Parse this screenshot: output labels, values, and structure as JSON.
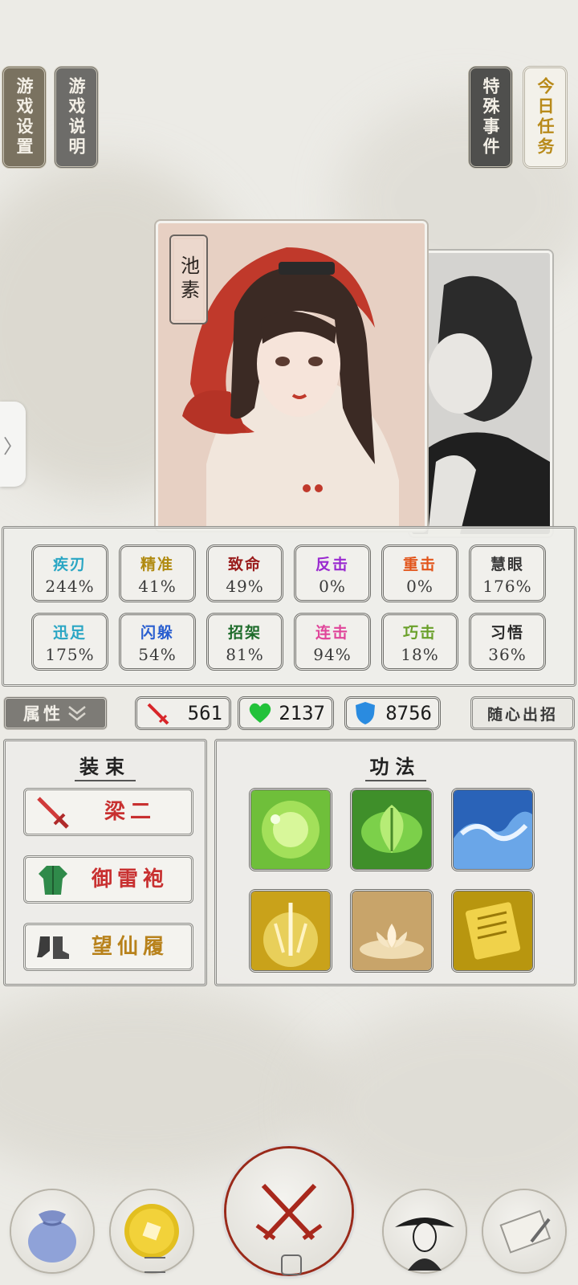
{
  "top_tags": {
    "game_settings": "游戏设置",
    "game_guide": "游戏说明",
    "special_events": "特殊事件",
    "daily_tasks": "今日任务"
  },
  "character": {
    "name": "池素"
  },
  "side_handle": {
    "glyph": "〉"
  },
  "stats": [
    {
      "label": "疾刃",
      "value": "244%",
      "color": "#2aa6c4"
    },
    {
      "label": "精准",
      "value": "41%",
      "color": "#b08a10"
    },
    {
      "label": "致命",
      "value": "49%",
      "color": "#9a1c1c"
    },
    {
      "label": "反击",
      "value": "0%",
      "color": "#9a2ad0"
    },
    {
      "label": "重击",
      "value": "0%",
      "color": "#e2551b"
    },
    {
      "label": "慧眼",
      "value": "176%",
      "color": "#3a3a3a"
    },
    {
      "label": "迅足",
      "value": "175%",
      "color": "#2aa6c4"
    },
    {
      "label": "闪躲",
      "value": "54%",
      "color": "#2a5fd0"
    },
    {
      "label": "招架",
      "value": "81%",
      "color": "#1d6b2a"
    },
    {
      "label": "连击",
      "value": "94%",
      "color": "#e0459a"
    },
    {
      "label": "巧击",
      "value": "18%",
      "color": "#6aa02a"
    },
    {
      "label": "习悟",
      "value": "36%",
      "color": "#2a2a2a"
    }
  ],
  "attributes": {
    "button_label": "属性",
    "attack": "561",
    "hp": "2137",
    "defense": "8756",
    "free_move_label": "随心出招"
  },
  "equipment": {
    "title": "装束",
    "items": [
      {
        "name": "梁二",
        "icon": "sword-icon",
        "color": "#c83030"
      },
      {
        "name": "御雷袍",
        "icon": "robe-icon",
        "color": "#c83030"
      },
      {
        "name": "望仙履",
        "icon": "boots-icon",
        "color": "#b8821c"
      }
    ]
  },
  "skills": {
    "title": "功法",
    "items": [
      {
        "icon": "green-orb-icon"
      },
      {
        "icon": "leaf-icon"
      },
      {
        "icon": "wave-icon"
      },
      {
        "icon": "golden-swords-icon"
      },
      {
        "icon": "lotus-icon"
      },
      {
        "icon": "golden-scroll-icon"
      }
    ]
  },
  "bottom_nav": [
    {
      "icon": "bag-icon"
    },
    {
      "icon": "coin-icon"
    },
    {
      "icon": "crossed-swords-icon"
    },
    {
      "icon": "hero-portrait-icon"
    },
    {
      "icon": "scroll-icon"
    }
  ]
}
